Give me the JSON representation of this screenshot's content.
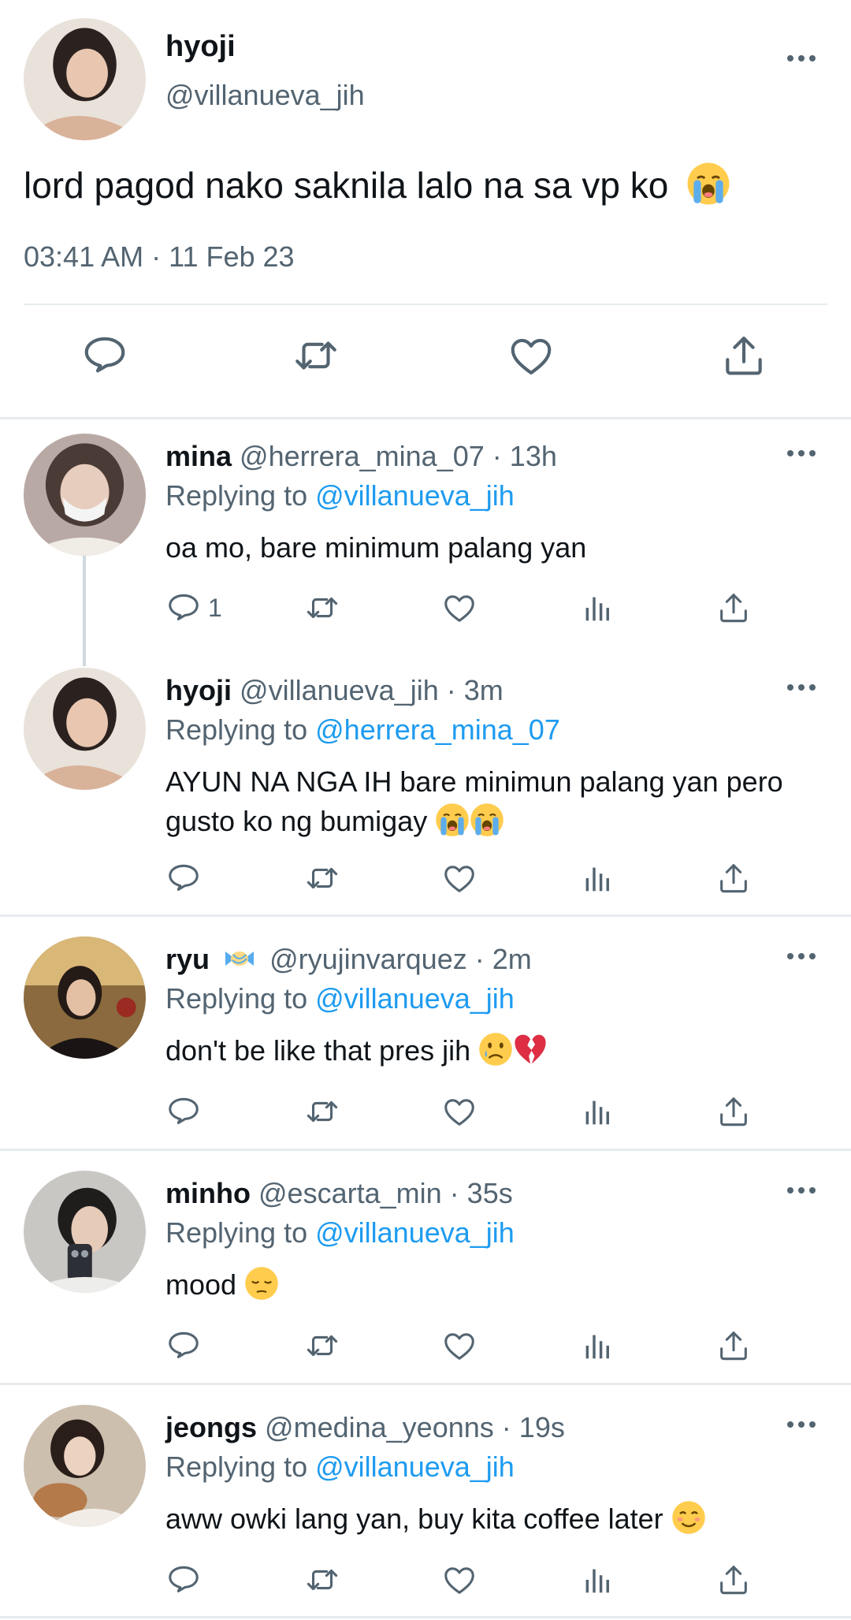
{
  "main_tweet": {
    "name": "hyoji",
    "handle": "@villanueva_jih",
    "text": "lord pagod nako saknila lalo na sa vp ko",
    "text_emoji": "loudly-crying-face",
    "timestamp": "03:41 AM · 11 Feb 23",
    "icons": [
      "reply-icon",
      "retweet-icon",
      "like-icon",
      "share-icon"
    ]
  },
  "replies": [
    {
      "name": "mina",
      "handle": "@herrera_mina_07",
      "time": "13h",
      "replying_label": "Replying to",
      "replying_to": "@villanueva_jih",
      "text": "oa mo, bare minimum palang yan",
      "reply_count": "1"
    },
    {
      "name": "hyoji",
      "handle": "@villanueva_jih",
      "time": "3m",
      "replying_label": "Replying to",
      "replying_to": "@herrera_mina_07",
      "text": "AYUN NA NGA IH bare minimun palang yan pero gusto ko ng bumigay",
      "text_emoji": [
        "loudly-crying-face",
        "loudly-crying-face"
      ]
    },
    {
      "name": "ryu",
      "name_badge": "candy-emoji",
      "handle": "@ryujinvarquez",
      "time": "2m",
      "replying_label": "Replying to",
      "replying_to": "@villanueva_jih",
      "text": "don't be like that pres jih",
      "text_emoji": [
        "crying-face",
        "broken-heart"
      ]
    },
    {
      "name": "minho",
      "handle": "@escarta_min",
      "time": "35s",
      "replying_label": "Replying to",
      "replying_to": "@villanueva_jih",
      "text": "mood",
      "text_emoji": [
        "pensive-face"
      ]
    },
    {
      "name": "jeongs",
      "handle": "@medina_yeonns",
      "time": "19s",
      "replying_label": "Replying to",
      "replying_to": "@villanueva_jih",
      "text": "aww owki lang yan, buy kita coffee later",
      "text_emoji": [
        "smiling-face"
      ]
    }
  ],
  "separator": "·",
  "colors": {
    "link": "#1d9bf0",
    "secondary": "#536471",
    "text": "#0f1419",
    "divider": "#e6ecf0"
  }
}
